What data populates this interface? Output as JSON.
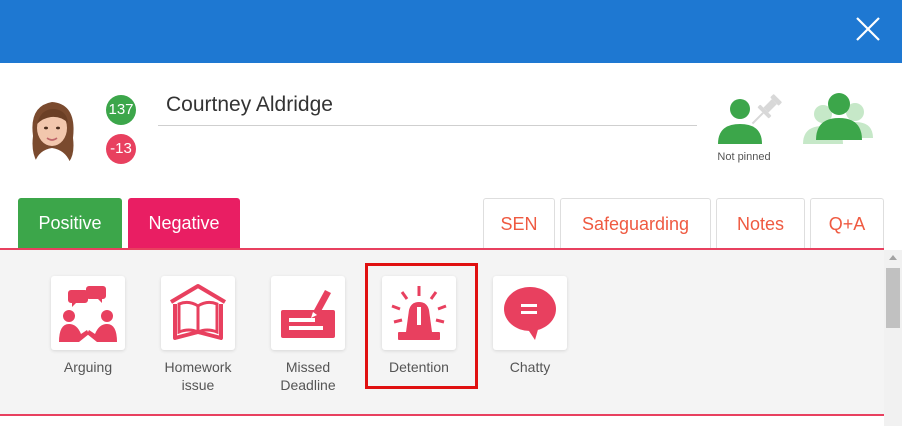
{
  "student": {
    "name": "Courtney Aldridge",
    "positive_points": "137",
    "negative_points": "-13",
    "pin_status": "Not pinned"
  },
  "tabs": [
    {
      "label": "Positive"
    },
    {
      "label": "Negative"
    },
    {
      "label": "SEN"
    },
    {
      "label": "Safeguarding"
    },
    {
      "label": "Notes"
    },
    {
      "label": "Q+A"
    }
  ],
  "behaviours": [
    {
      "label": "Arguing",
      "icon": "arguing-people-icon"
    },
    {
      "label": "Homework issue",
      "icon": "open-book-icon"
    },
    {
      "label": "Missed Deadline",
      "icon": "deadline-sign-icon"
    },
    {
      "label": "Detention",
      "icon": "siren-light-icon"
    },
    {
      "label": "Chatty",
      "icon": "speech-bubble-icon"
    }
  ],
  "colors": {
    "header": "#1e78d2",
    "positive": "#3ca64a",
    "negative": "#e91e63",
    "accent_text": "#ef5a41",
    "behaviour_icon": "#e8405f",
    "highlight": "#e01010"
  }
}
